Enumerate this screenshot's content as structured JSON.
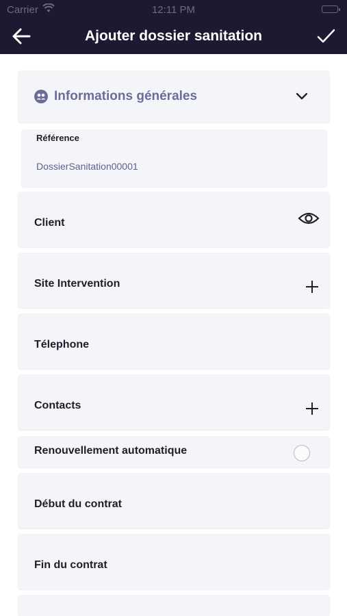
{
  "status_bar": {
    "carrier": "Carrier",
    "time": "12:11 PM"
  },
  "navbar": {
    "title": "Ajouter dossier sanitation"
  },
  "section": {
    "title": "Informations générales"
  },
  "reference": {
    "label": "Référence",
    "value": "DossierSanitation00001"
  },
  "fields": {
    "client": "Client",
    "site": "Site Intervention",
    "telephone": "Télephone",
    "contacts": "Contacts",
    "renewal": "Renouvellement automatique",
    "start": "Début du contrat",
    "end": "Fin du contrat"
  },
  "colors": {
    "header_bg": "#1f1833",
    "accent": "#6b6c9a",
    "card_bg": "#f4f5f9"
  },
  "icons": [
    "back-arrow-icon",
    "check-icon",
    "people-icon",
    "chevron-down-icon",
    "eye-icon",
    "plus-icon",
    "wifi-icon",
    "battery-icon"
  ]
}
